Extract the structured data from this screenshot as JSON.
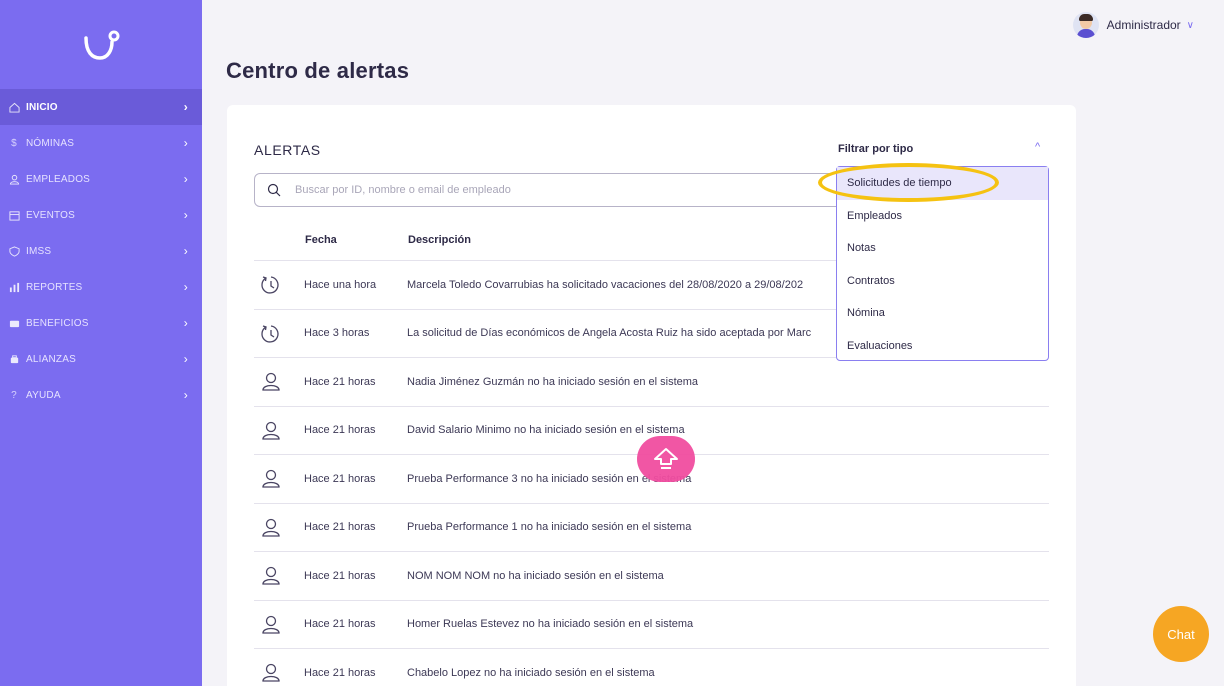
{
  "sidebar": {
    "items": [
      {
        "label": "INICIO",
        "icon": "home-icon"
      },
      {
        "label": "NÓMINAS",
        "icon": "dollar-icon"
      },
      {
        "label": "EMPLEADOS",
        "icon": "people-icon"
      },
      {
        "label": "EVENTOS",
        "icon": "calendar-icon"
      },
      {
        "label": "IMSS",
        "icon": "shield-icon"
      },
      {
        "label": "REPORTES",
        "icon": "bar-chart-icon"
      },
      {
        "label": "BENEFICIOS",
        "icon": "card-icon"
      },
      {
        "label": "ALIANZAS",
        "icon": "handshake-icon"
      },
      {
        "label": "AYUDA",
        "icon": "question-icon"
      }
    ],
    "chevron": "›"
  },
  "header": {
    "user_name": "Administrador",
    "caret": "∨"
  },
  "page": {
    "title": "Centro de alertas"
  },
  "alerts": {
    "title": "ALERTAS",
    "search_placeholder": "Buscar por ID, nombre o email de empleado",
    "filter_label": "Filtrar por tipo",
    "filter_caret": "^",
    "columns": {
      "date": "Fecha",
      "description": "Descripción"
    },
    "rows": [
      {
        "icon": "clock-icon",
        "date": "Hace una hora",
        "description": "Marcela Toledo Covarrubias ha solicitado vacaciones del 28/08/2020 a 29/08/202"
      },
      {
        "icon": "clock-icon",
        "date": "Hace 3 horas",
        "description": "La solicitud de Días económicos de Angela Acosta Ruiz ha sido aceptada por Marc"
      },
      {
        "icon": "user-icon",
        "date": "Hace 21 horas",
        "description": "Nadia Jiménez Guzmán no ha iniciado sesión en el sistema"
      },
      {
        "icon": "user-icon",
        "date": "Hace 21 horas",
        "description": "David Salario Minimo no ha iniciado sesión en el sistema"
      },
      {
        "icon": "user-icon",
        "date": "Hace 21 horas",
        "description": "Prueba Performance 3 no ha iniciado sesión en el sistema"
      },
      {
        "icon": "user-icon",
        "date": "Hace 21 horas",
        "description": "Prueba Performance 1 no ha iniciado sesión en el sistema"
      },
      {
        "icon": "user-icon",
        "date": "Hace 21 horas",
        "description": "NOM NOM NOM no ha iniciado sesión en el sistema"
      },
      {
        "icon": "user-icon",
        "date": "Hace 21 horas",
        "description": "Homer Ruelas Estevez no ha iniciado sesión en el sistema"
      },
      {
        "icon": "user-icon",
        "date": "Hace 21 horas",
        "description": "Chabelo Lopez no ha iniciado sesión en el sistema"
      }
    ]
  },
  "filter_dropdown": {
    "options": [
      "Solicitudes de tiempo",
      "Empleados",
      "Notas",
      "Contratos",
      "Nómina",
      "Evaluaciones"
    ],
    "highlighted": "Solicitudes de tiempo"
  },
  "chat": {
    "label": "Chat"
  },
  "colors": {
    "sidebar": "#7b6cf0",
    "sidebar_active": "#6a5bd9",
    "accent": "#7b6cf0",
    "highlight_ring": "#f5c211",
    "scroll_button": "#f14da0",
    "chat_button": "#f6a623"
  }
}
